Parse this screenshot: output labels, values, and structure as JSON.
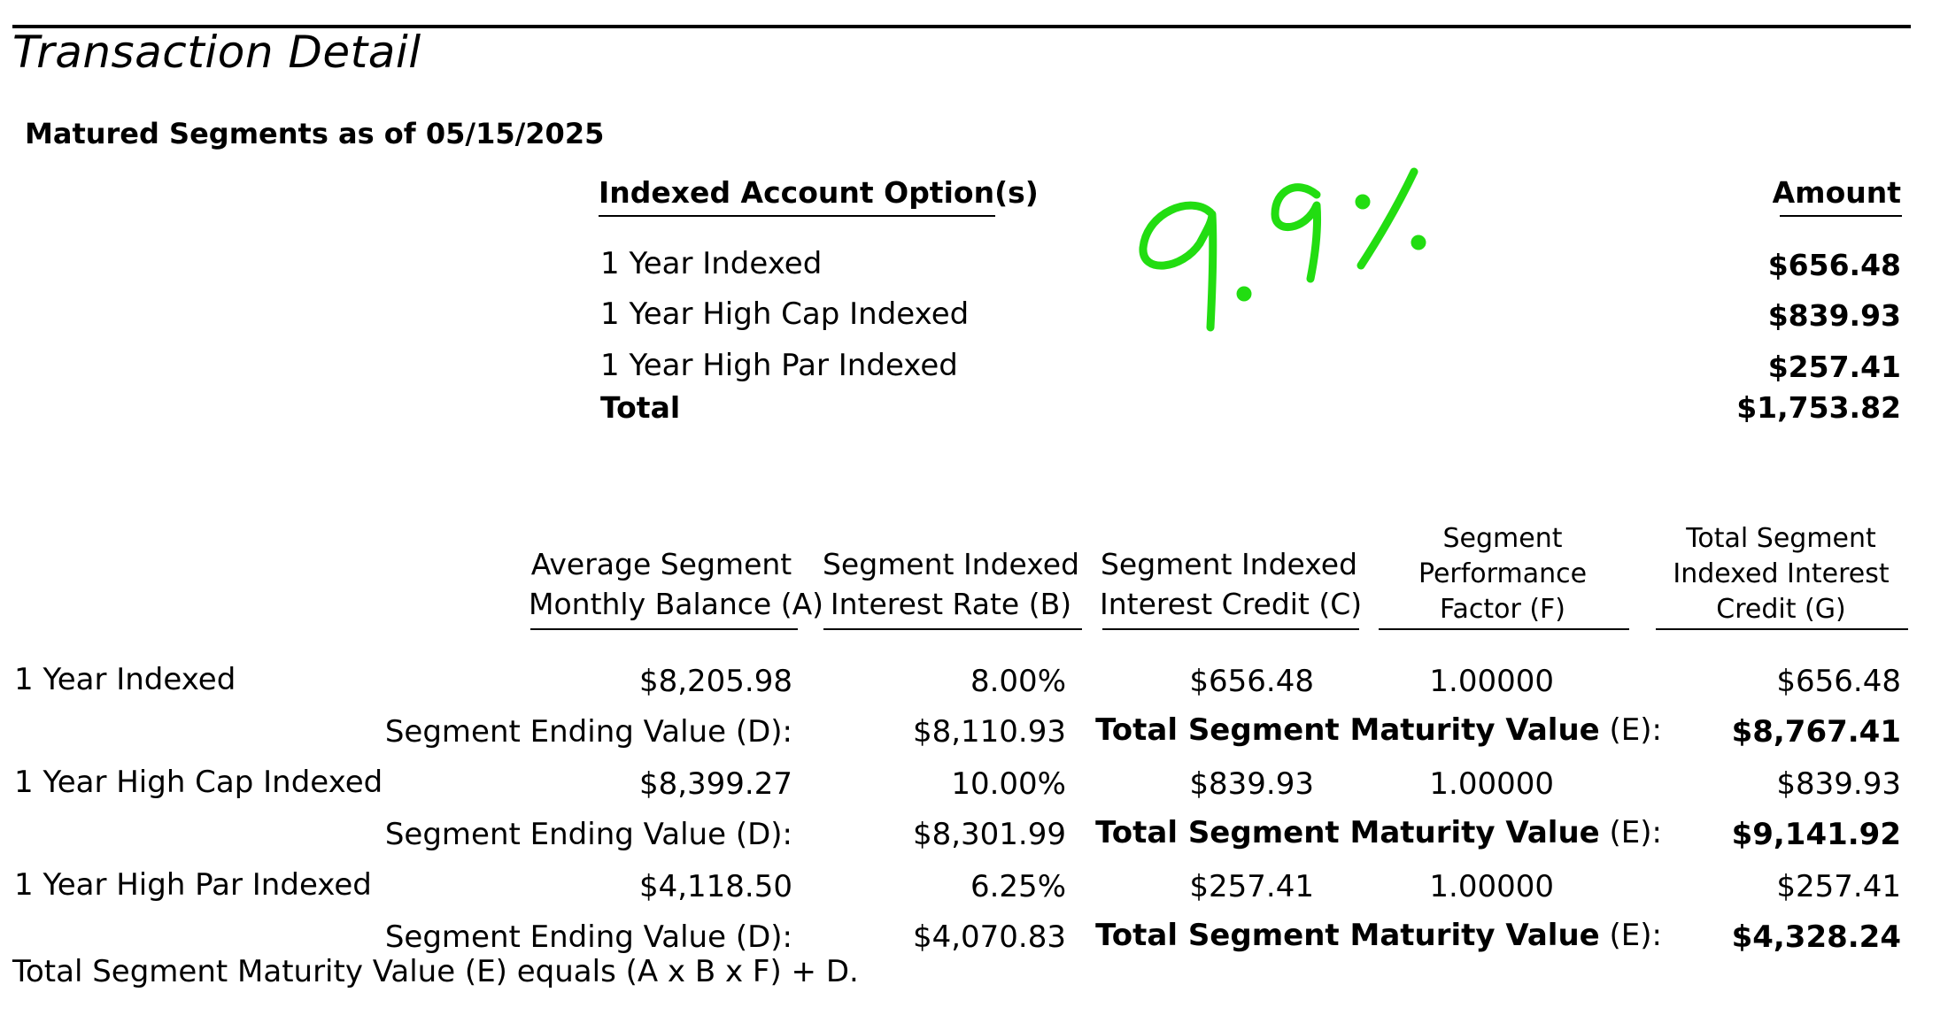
{
  "document": {
    "title": "Transaction Detail",
    "subtitle": "Matured Segments as of 05/15/2025"
  },
  "summary": {
    "option_header": "Indexed Account Option(s)",
    "amount_header": "Amount",
    "items": [
      {
        "option": "1 Year Indexed",
        "amount": "$656.48"
      },
      {
        "option": "1 Year High Cap Indexed",
        "amount": "$839.93"
      },
      {
        "option": "1 Year High Par Indexed",
        "amount": "$257.41"
      }
    ],
    "total_label": "Total",
    "total_amount": "$1,753.82"
  },
  "handwritten_annotation": {
    "text": "9.9%",
    "color": "#22dd11"
  },
  "detail": {
    "columns": [
      {
        "lines": [
          "Average Segment",
          "Monthly Balance (A)"
        ]
      },
      {
        "lines": [
          "Segment Indexed",
          "Interest Rate (B)"
        ]
      },
      {
        "lines": [
          "Segment Indexed",
          "Interest Credit (C)"
        ]
      },
      {
        "lines": [
          "Segment",
          "Performance",
          "Factor (F)"
        ]
      },
      {
        "lines": [
          "Total Segment",
          "Indexed Interest",
          "Credit (G)"
        ]
      }
    ],
    "segments": [
      {
        "name": "1 Year Indexed",
        "avg_balance": "$8,205.98",
        "rate": "8.00%",
        "credit": "$656.48",
        "factor": "1.00000",
        "total_credit": "$656.48",
        "ending_label": "Segment Ending Value (D):",
        "ending_value": "$8,110.93",
        "maturity_label": "Total Segment Maturity Value",
        "maturity_suffix": " (E):",
        "maturity_value": "$8,767.41"
      },
      {
        "name": "1 Year High Cap Indexed",
        "avg_balance": "$8,399.27",
        "rate": "10.00%",
        "credit": "$839.93",
        "factor": "1.00000",
        "total_credit": "$839.93",
        "ending_label": "Segment Ending Value (D):",
        "ending_value": "$8,301.99",
        "maturity_label": "Total Segment Maturity Value",
        "maturity_suffix": " (E):",
        "maturity_value": "$9,141.92"
      },
      {
        "name": "1 Year High Par Indexed",
        "avg_balance": "$4,118.50",
        "rate": "6.25%",
        "credit": "$257.41",
        "factor": "1.00000",
        "total_credit": "$257.41",
        "ending_label": "Segment Ending Value (D):",
        "ending_value": "$4,070.83",
        "maturity_label": "Total Segment Maturity Value",
        "maturity_suffix": " (E):",
        "maturity_value": "$4,328.24"
      }
    ],
    "footnote": "Total Segment Maturity Value (E) equals (A x B x F) + D."
  }
}
